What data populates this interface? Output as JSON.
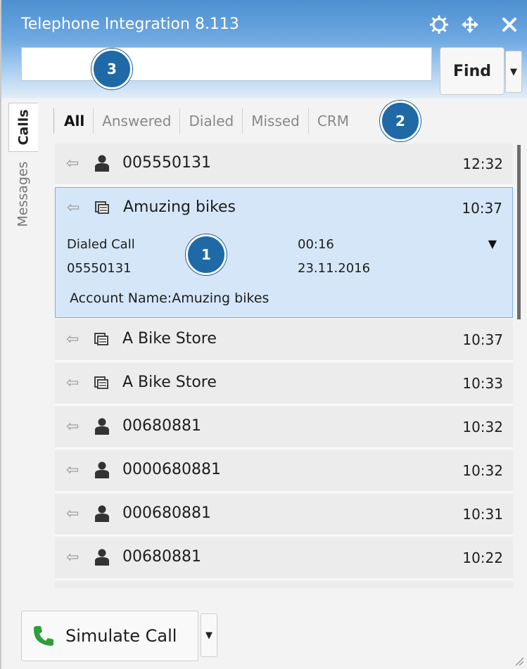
{
  "window": {
    "title": "Telephone Integration 8.113"
  },
  "titlebar_icons": [
    "settings-icon",
    "move-icon",
    "close-icon"
  ],
  "search": {
    "value": "",
    "placeholder": "",
    "find_label": "Find"
  },
  "badges": [
    "1",
    "2",
    "3"
  ],
  "side_tabs": [
    {
      "label": "Calls",
      "active": true
    },
    {
      "label": "Messages",
      "active": false
    }
  ],
  "filters": [
    {
      "label": "All",
      "active": true
    },
    {
      "label": "Answered",
      "active": false
    },
    {
      "label": "Dialed",
      "active": false
    },
    {
      "label": "Missed",
      "active": false
    },
    {
      "label": "CRM",
      "active": false
    }
  ],
  "calls": [
    {
      "icon": "person-icon",
      "name": "005550131",
      "time": "12:32"
    },
    {
      "icon": "account-icon",
      "name": "Amuzing bikes",
      "time": "10:37",
      "expanded": true,
      "details": {
        "type": "Dialed Call",
        "duration": "00:16",
        "number": "05550131",
        "date": "23.11.2016",
        "account": "Account Name:Amuzing bikes"
      }
    },
    {
      "icon": "account-icon",
      "name": "A Bike Store",
      "time": "10:37"
    },
    {
      "icon": "account-icon",
      "name": "A Bike Store",
      "time": "10:33"
    },
    {
      "icon": "person-icon",
      "name": "00680881",
      "time": "10:32"
    },
    {
      "icon": "person-icon",
      "name": "0000680881",
      "time": "10:32"
    },
    {
      "icon": "person-icon",
      "name": "000680881",
      "time": "10:31"
    },
    {
      "icon": "person-icon",
      "name": "00680881",
      "time": "10:22"
    }
  ],
  "simulate": {
    "label": "Simulate Call"
  },
  "colors": {
    "titlebar": "#4d8fd0",
    "badge": "#1f6aa6",
    "selection": "#d5e6f8",
    "phone_green": "#2e9d3a"
  }
}
